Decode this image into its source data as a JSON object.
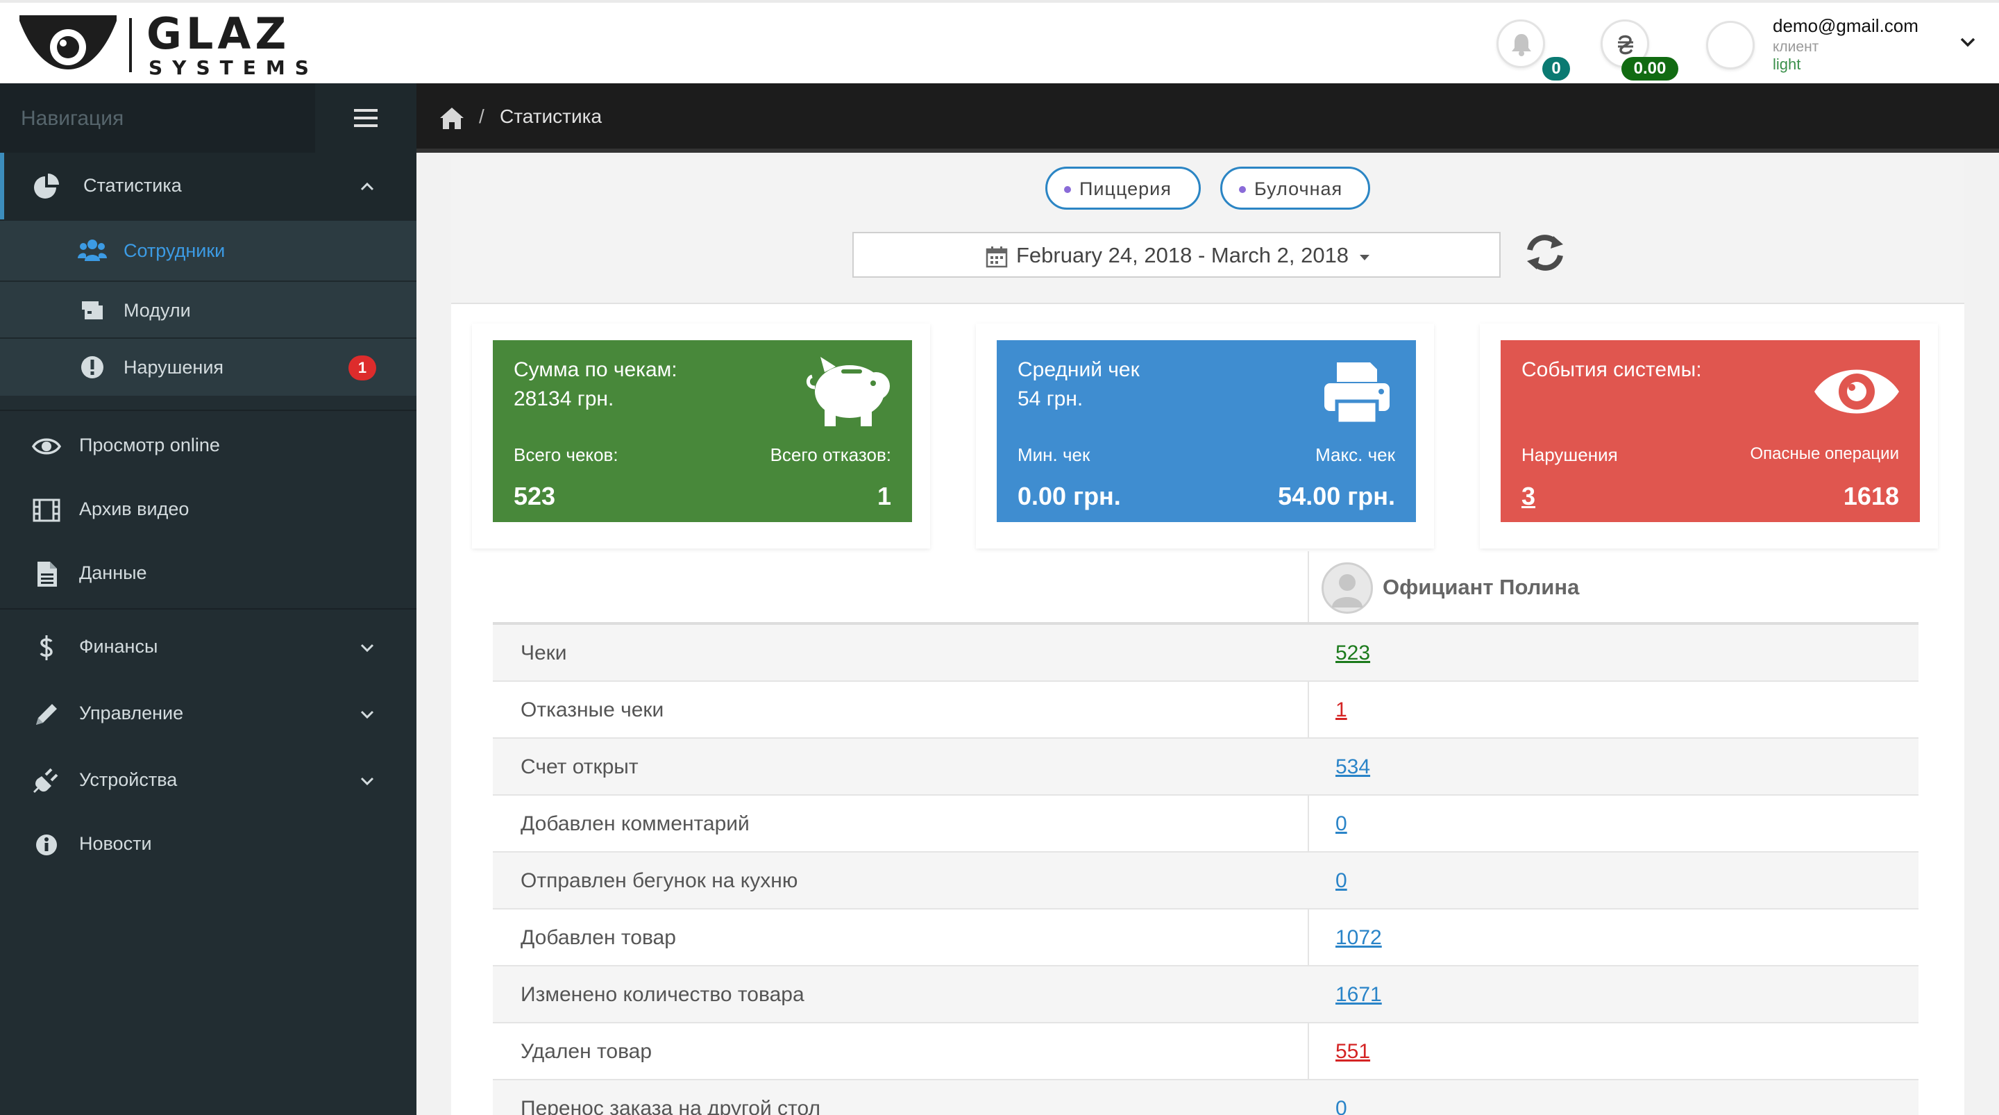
{
  "brand": {
    "name": "GLAZ",
    "sub": "SYSTEMS"
  },
  "header": {
    "notifications_count": "0",
    "balance": "0.00",
    "user": {
      "email": "demo@gmail.com",
      "role": "клиент",
      "theme": "light"
    }
  },
  "sidebar": {
    "heading": "Навигация",
    "items": [
      {
        "label": "Статистика"
      },
      {
        "label": "Сотрудники"
      },
      {
        "label": "Модули"
      },
      {
        "label": "Нарушения",
        "badge": "1"
      },
      {
        "label": "Просмотр online"
      },
      {
        "label": "Архив видео"
      },
      {
        "label": "Данные"
      },
      {
        "label": "Финансы"
      },
      {
        "label": "Управление"
      },
      {
        "label": "Устройства"
      },
      {
        "label": "Новости"
      }
    ]
  },
  "breadcrumb": {
    "separator": "/",
    "current": "Статистика"
  },
  "filters": {
    "locations": [
      "Пиццерия",
      "Булочная"
    ],
    "date_range": "February 24, 2018 - March 2, 2018"
  },
  "cards": [
    {
      "title": "Сумма по чекам:",
      "value": "28134 грн.",
      "left_label": "Всего чеков:",
      "right_label": "Всего отказов:",
      "left_value": "523",
      "right_value": "1",
      "color": "#48883a",
      "icon": "piggy-bank-icon"
    },
    {
      "title": "Средний чек",
      "value": "54 грн.",
      "left_label": "Мин. чек",
      "right_label": "Макс. чек",
      "left_value": "0.00 грн.",
      "right_value": "54.00 грн.",
      "color": "#3f8dd0",
      "icon": "printer-icon"
    },
    {
      "title": "События системы:",
      "value": "",
      "left_label": "Нарушения",
      "right_label": "Опасные операции",
      "left_value": "3",
      "right_value": "1618",
      "color": "#e0564f",
      "icon": "eye-icon"
    }
  ],
  "table": {
    "employee": "Официант Полина",
    "rows": [
      {
        "name": "Чеки",
        "value": "523",
        "color": "#1c7a1c"
      },
      {
        "name": "Отказные чеки",
        "value": "1",
        "color": "#d42424"
      },
      {
        "name": "Счет открыт",
        "value": "534",
        "color": "#2a84c8"
      },
      {
        "name": "Добавлен комментарий",
        "value": "0",
        "color": "#2a84c8"
      },
      {
        "name": "Отправлен бегунок на кухню",
        "value": "0",
        "color": "#2a84c8"
      },
      {
        "name": "Добавлен товар",
        "value": "1072",
        "color": "#2a84c8"
      },
      {
        "name": "Изменено количество товара",
        "value": "1671",
        "color": "#2a84c8"
      },
      {
        "name": "Удален товар",
        "value": "551",
        "color": "#d42424"
      },
      {
        "name": "Перенос заказа на другой стол",
        "value": "0",
        "color": "#2a84c8"
      }
    ]
  }
}
